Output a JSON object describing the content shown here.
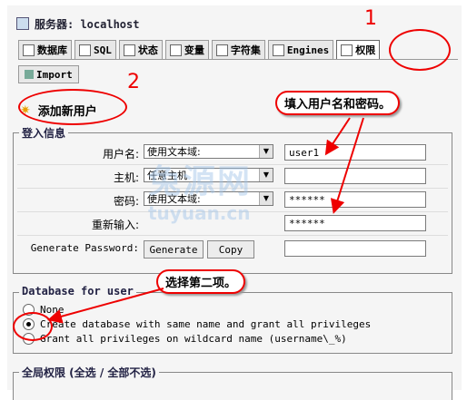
{
  "header": {
    "server_label": "服务器: localhost"
  },
  "tabs": [
    {
      "label": "数据库",
      "icon": "database-icon"
    },
    {
      "label": "SQL",
      "icon": "sql-icon"
    },
    {
      "label": "状态",
      "icon": "status-icon"
    },
    {
      "label": "变量",
      "icon": "variables-icon"
    },
    {
      "label": "字符集",
      "icon": "charset-icon"
    },
    {
      "label": "Engines",
      "icon": "engines-icon"
    },
    {
      "label": "权限",
      "icon": "privileges-icon"
    }
  ],
  "subtab": {
    "label": "Import"
  },
  "add_user_title": "添加新用户",
  "login": {
    "legend": "登入信息",
    "rows": [
      {
        "label": "用户名:",
        "select": "使用文本域:",
        "value": "user1"
      },
      {
        "label": "主机:",
        "select": "任意主机",
        "value": ""
      },
      {
        "label": "密码:",
        "select": "使用文本域:",
        "value": "******"
      },
      {
        "label": "重新输入:",
        "value": "******"
      }
    ],
    "generate_label": "Generate Password:",
    "generate_button": "Generate",
    "copy_button": "Copy",
    "generated_value": ""
  },
  "database_for_user": {
    "legend": "Database for user",
    "options": [
      {
        "label": "None",
        "checked": false
      },
      {
        "label": "Create database with same name and grant all privileges",
        "checked": true
      },
      {
        "label": "Grant all privileges on wildcard name (username\\_%)",
        "checked": false
      }
    ]
  },
  "global_privileges_legend": "全局权限 (全选 / 全部不选)",
  "annotations": {
    "num1": "1",
    "num2": "2",
    "callout_userpass": "填入用户名和密码。",
    "callout_option": "选择第二项。"
  },
  "watermark": {
    "cn": "兔源网",
    "en": "tuyuan.cn"
  },
  "colors": {
    "annotation_red": "#e00000",
    "background": "#f5f5f5"
  }
}
